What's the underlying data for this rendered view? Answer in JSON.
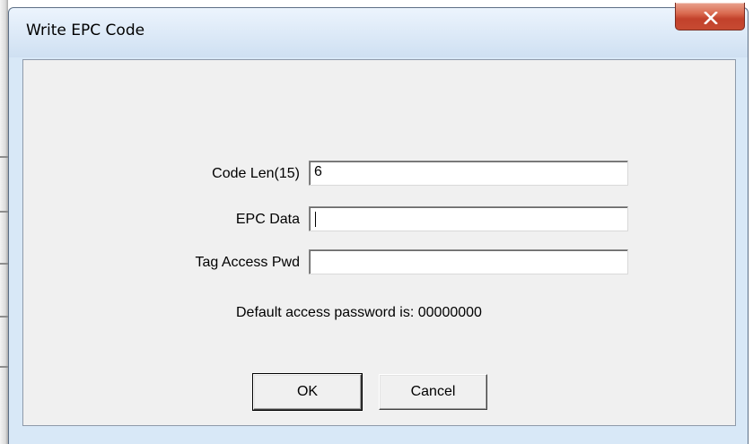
{
  "window": {
    "title": "Write EPC Code",
    "close_icon": "close-x-icon"
  },
  "form": {
    "code_len": {
      "label": "Code Len(15)",
      "value": "6"
    },
    "epc_data": {
      "label": "EPC Data",
      "value": ""
    },
    "access_pwd": {
      "label": "Tag Access Pwd",
      "value": ""
    },
    "info": "Default access password is: 00000000"
  },
  "buttons": {
    "ok": "OK",
    "cancel": "Cancel"
  },
  "colors": {
    "dialog_frame": "#d8e8f7",
    "client_bg": "#f0f0f0",
    "close_button": "#c2412b"
  }
}
